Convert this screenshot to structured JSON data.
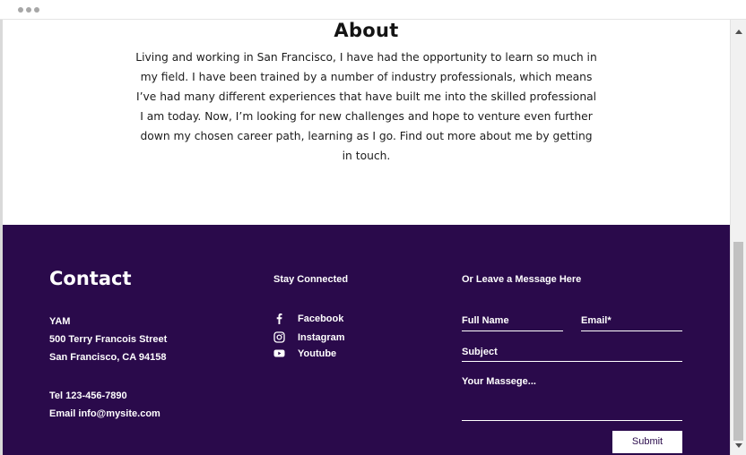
{
  "about": {
    "title": "About",
    "text": "Living and working in San Francisco, I have had the opportunity to learn so much in my field. I have been trained by a number of industry professionals, which means I’ve had many different experiences that have built me into the skilled professional I am today. Now, I’m looking for new challenges and hope to venture even further down my chosen career path, learning as I go. Find out more about me by getting in touch."
  },
  "contact": {
    "title": "Contact",
    "name": "YAM",
    "street": "500 Terry Francois Street",
    "city": "San Francisco, CA 94158",
    "tel": "Tel 123-456-7890",
    "email": "Email info@mysite.com"
  },
  "social": {
    "heading": "Stay Connected",
    "items": [
      {
        "label": "Facebook",
        "icon": "facebook-icon"
      },
      {
        "label": "Instagram",
        "icon": "instagram-icon"
      },
      {
        "label": "Youtube",
        "icon": "youtube-icon"
      }
    ]
  },
  "form": {
    "heading": "Or Leave a Message Here",
    "full_name_label": "Full Name",
    "email_label": "Email*",
    "subject_label": "Subject",
    "message_label": "Your Massege...",
    "submit_label": "Submit"
  },
  "colors": {
    "footer_bg": "#2a0a4b",
    "text_light": "#ffffff",
    "text_dark": "#141414"
  }
}
